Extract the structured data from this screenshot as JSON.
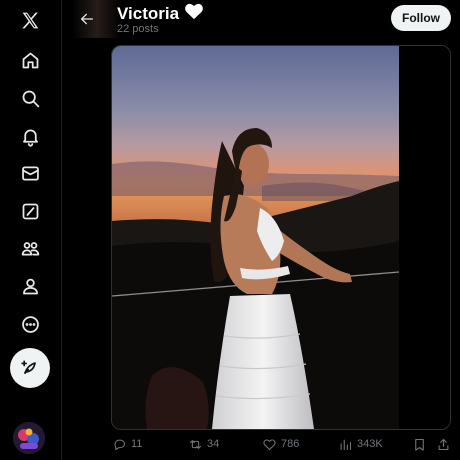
{
  "app": {
    "logo_icon": "x-logo-icon"
  },
  "nav": [
    {
      "id": "home",
      "icon": "home-icon"
    },
    {
      "id": "explore",
      "icon": "search-icon"
    },
    {
      "id": "notifications",
      "icon": "bell-icon"
    },
    {
      "id": "messages",
      "icon": "envelope-icon"
    },
    {
      "id": "grok",
      "icon": "grok-icon"
    },
    {
      "id": "communities",
      "icon": "people-icon"
    },
    {
      "id": "profile",
      "icon": "person-icon"
    },
    {
      "id": "more",
      "icon": "more-circle-icon"
    }
  ],
  "compose": {
    "icon": "feather-plus-icon"
  },
  "header": {
    "name": "Victoria",
    "name_emoji": "white-heart-icon",
    "subtitle": "22 posts",
    "follow_label": "Follow"
  },
  "post": {
    "media_alt_icon": "photo",
    "replies": "11",
    "reposts": "34",
    "likes": "786",
    "views": "343K"
  },
  "colors": {
    "background": "#000000",
    "text": "#e7e9ea",
    "muted": "#71767b",
    "button_bg": "#eff3f4",
    "button_text": "#0f1419"
  }
}
